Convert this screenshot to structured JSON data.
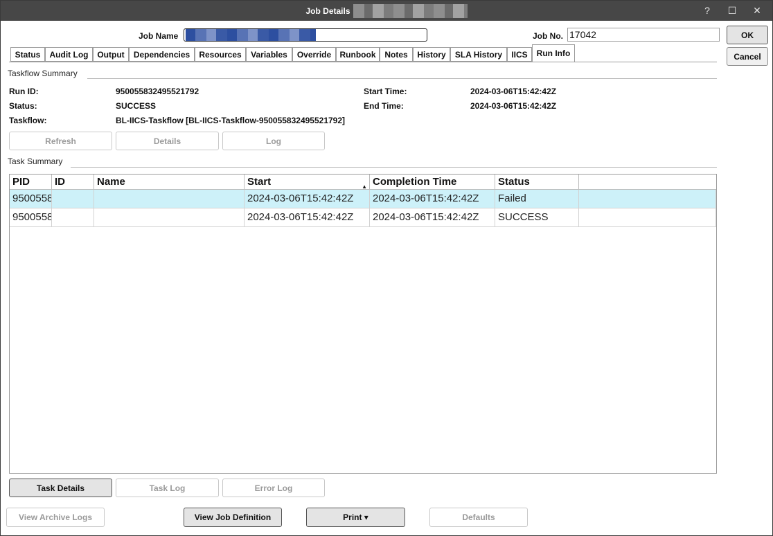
{
  "window": {
    "title": "Job Details",
    "help_glyph": "?",
    "maximize_glyph": "☐",
    "close_glyph": "✕"
  },
  "header": {
    "job_name_label": "Job Name",
    "job_no_label": "Job No.",
    "job_no_value": "17042"
  },
  "actions": {
    "ok": "OK",
    "cancel": "Cancel"
  },
  "tabs": [
    {
      "label": "Status"
    },
    {
      "label": "Audit Log"
    },
    {
      "label": "Output"
    },
    {
      "label": "Dependencies"
    },
    {
      "label": "Resources"
    },
    {
      "label": "Variables"
    },
    {
      "label": "Override"
    },
    {
      "label": "Runbook"
    },
    {
      "label": "Notes"
    },
    {
      "label": "History"
    },
    {
      "label": "SLA History"
    },
    {
      "label": "IICS"
    },
    {
      "label": "Run Info",
      "active": true
    }
  ],
  "taskflow_summary": {
    "section_label": "Taskflow Summary",
    "run_id_label": "Run ID:",
    "run_id_value": "950055832495521792",
    "status_label": "Status:",
    "status_value": "SUCCESS",
    "taskflow_label": "Taskflow:",
    "taskflow_value": "BL-IICS-Taskflow [BL-IICS-Taskflow-950055832495521792]",
    "start_time_label": "Start Time:",
    "start_time_value": "2024-03-06T15:42:42Z",
    "end_time_label": "End Time:",
    "end_time_value": "2024-03-06T15:42:42Z",
    "buttons": {
      "refresh": "Refresh",
      "details": "Details",
      "log": "Log"
    }
  },
  "task_summary": {
    "section_label": "Task Summary",
    "columns": [
      "PID",
      "ID",
      "Name",
      "Start",
      "Completion Time",
      "Status"
    ],
    "sort_indicator": "▲",
    "rows": [
      {
        "pid": "9500558",
        "id": "",
        "name": "",
        "start": "2024-03-06T15:42:42Z",
        "completion": "2024-03-06T15:42:42Z",
        "status": "Failed",
        "selected": true
      },
      {
        "pid": "9500558",
        "id": "",
        "name": "",
        "start": "2024-03-06T15:42:42Z",
        "completion": "2024-03-06T15:42:42Z",
        "status": "SUCCESS",
        "selected": false
      }
    ],
    "buttons": {
      "task_details": "Task Details",
      "task_log": "Task Log",
      "error_log": "Error Log"
    }
  },
  "footer": {
    "view_archive_logs": "View Archive Logs",
    "view_job_definition": "View Job Definition",
    "print": "Print ▾",
    "defaults": "Defaults"
  },
  "colors": {
    "titlebar": "#474747",
    "selected_row": "#cdf1f9"
  }
}
